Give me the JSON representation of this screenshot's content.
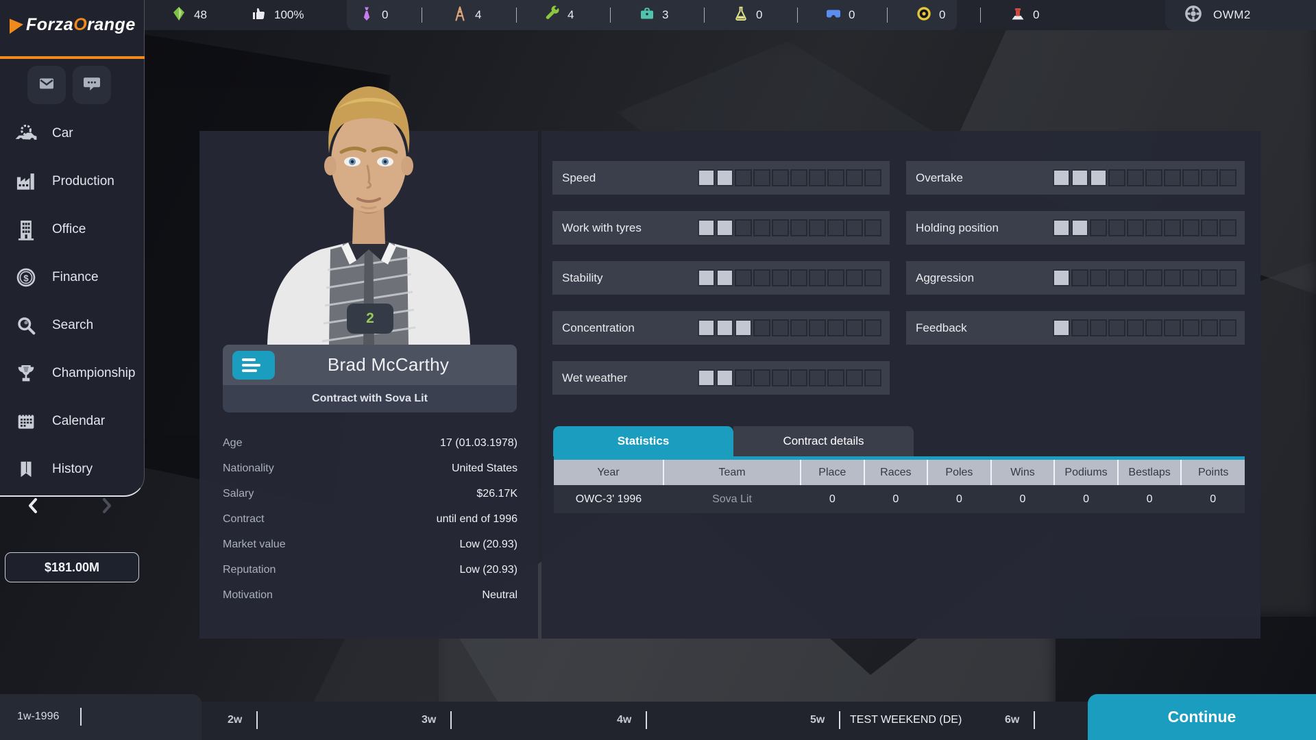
{
  "topbar": {
    "resources": [
      {
        "icon": "gem-icon",
        "value": "48"
      },
      {
        "icon": "thumbs-up-icon",
        "value": "100%"
      },
      {
        "icon": "tie-icon",
        "value": "0"
      },
      {
        "icon": "tower-icon",
        "value": "4"
      },
      {
        "icon": "wrench-icon",
        "value": "4"
      },
      {
        "icon": "briefcase-icon",
        "value": "3"
      },
      {
        "icon": "flask-icon",
        "value": "0"
      },
      {
        "icon": "goggles-icon",
        "value": "0"
      },
      {
        "icon": "tyre-icon",
        "value": "0"
      },
      {
        "icon": "piston-icon",
        "value": "0"
      }
    ],
    "profile": {
      "icon": "steering-wheel-icon",
      "label": "OWM2"
    }
  },
  "brand": {
    "name_left": "Forza",
    "name_accent": "O",
    "name_right": "range",
    "accent_color": "#f18a1d"
  },
  "sidebar": {
    "quick_icons": [
      {
        "icon": "mail-icon"
      },
      {
        "icon": "chat-icon"
      }
    ],
    "items": [
      {
        "icon": "car-icon",
        "label": "Car"
      },
      {
        "icon": "factory-icon",
        "label": "Production"
      },
      {
        "icon": "building-icon",
        "label": "Office"
      },
      {
        "icon": "coin-icon",
        "label": "Finance"
      },
      {
        "icon": "magnifier-icon",
        "label": "Search"
      },
      {
        "icon": "trophy-icon",
        "label": "Championship"
      },
      {
        "icon": "calendar-icon",
        "label": "Calendar"
      },
      {
        "icon": "bookmark-icon",
        "label": "History"
      }
    ],
    "budget": "$181.00M"
  },
  "driver": {
    "number": "2",
    "name": "Brad McCarthy",
    "subtitle": "Contract with Sova Lit",
    "info": [
      {
        "label": "Age",
        "value": "17 (01.03.1978)"
      },
      {
        "label": "Nationality",
        "value": "United States"
      },
      {
        "label": "Salary",
        "value": "$26.17K"
      },
      {
        "label": "Contract",
        "value": "until end of 1996"
      },
      {
        "label": "Market value",
        "value": "Low (20.93)"
      },
      {
        "label": "Reputation",
        "value": "Low (20.93)"
      },
      {
        "label": "Motivation",
        "value": "Neutral"
      }
    ]
  },
  "skills": {
    "max": 10,
    "left": [
      {
        "label": "Speed",
        "value": 2
      },
      {
        "label": "Work with tyres",
        "value": 2
      },
      {
        "label": "Stability",
        "value": 2
      },
      {
        "label": "Concentration",
        "value": 3
      },
      {
        "label": "Wet weather",
        "value": 2
      }
    ],
    "right": [
      {
        "label": "Overtake",
        "value": 3
      },
      {
        "label": "Holding position",
        "value": 2
      },
      {
        "label": "Aggression",
        "value": 1
      },
      {
        "label": "Feedback",
        "value": 1
      }
    ]
  },
  "tabs": [
    {
      "label": "Statistics",
      "active": true
    },
    {
      "label": "Contract details",
      "active": false
    }
  ],
  "stats_table": {
    "columns": [
      "Year",
      "Team",
      "Place",
      "Races",
      "Poles",
      "Wins",
      "Podiums",
      "Bestlaps",
      "Points"
    ],
    "rows": [
      {
        "year": "OWC-3' 1996",
        "team": "Sova Lit",
        "values": [
          "0",
          "0",
          "0",
          "0",
          "0",
          "0",
          "0"
        ]
      }
    ]
  },
  "timeline": {
    "current_week": "1w-1996",
    "weeks": [
      {
        "label": "2w"
      },
      {
        "label": "3w"
      },
      {
        "label": "4w"
      },
      {
        "label": "5w",
        "event": "TEST WEEKEND (DE)"
      },
      {
        "label": "6w"
      }
    ],
    "continue_label": "Continue"
  },
  "colors": {
    "accent_teal": "#1b9dbf",
    "accent_orange": "#f18a1d",
    "filled_square": "#c3c7d1"
  }
}
